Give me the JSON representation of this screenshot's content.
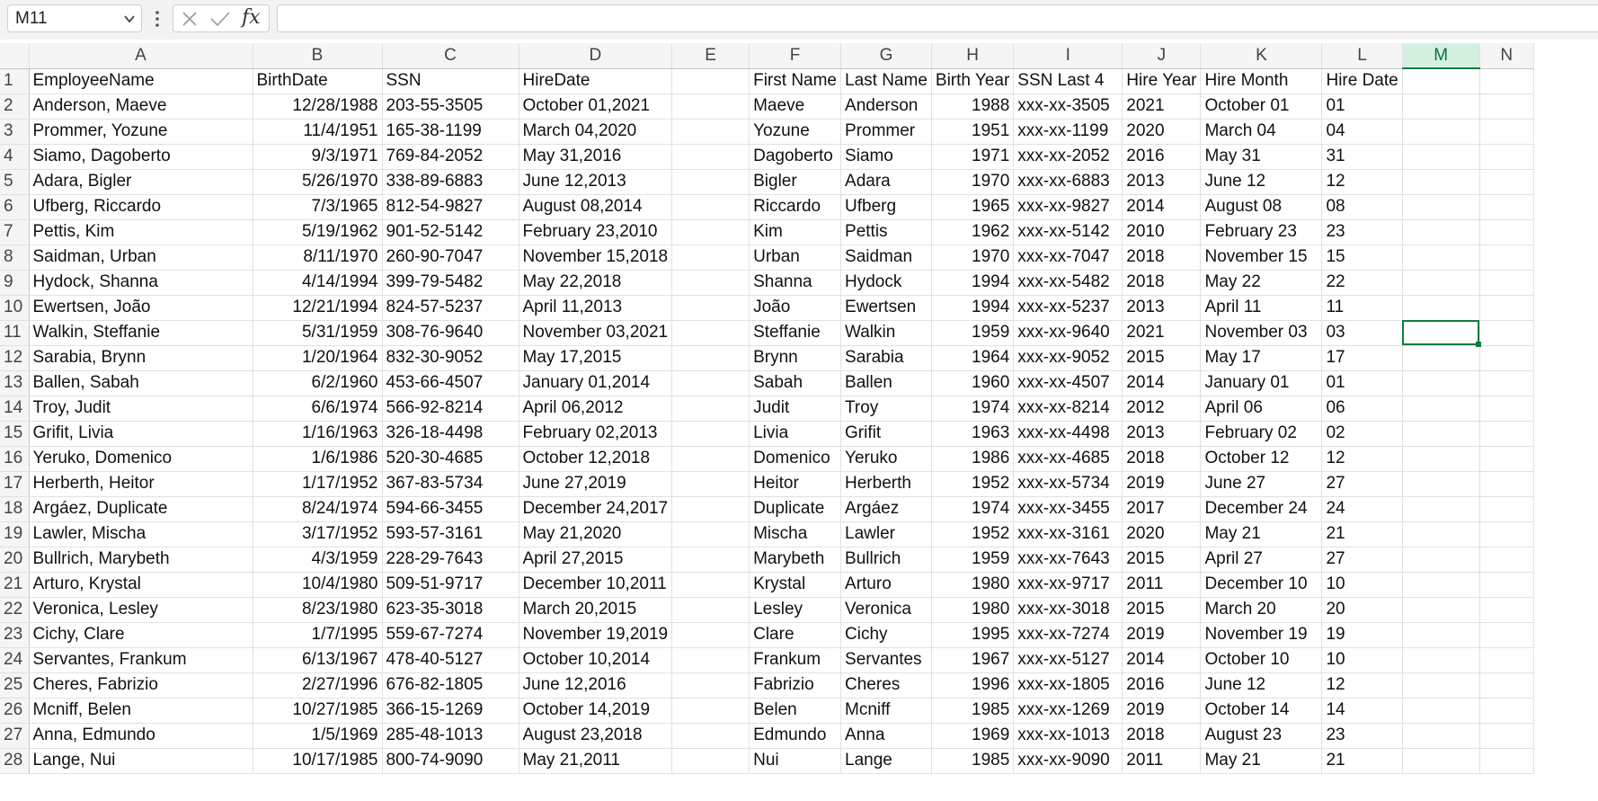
{
  "formula_bar": {
    "name_box": "M11",
    "function_symbol": "fx",
    "formula_value": ""
  },
  "columns": [
    "A",
    "B",
    "C",
    "D",
    "E",
    "F",
    "G",
    "H",
    "I",
    "J",
    "K",
    "L",
    "M",
    "N"
  ],
  "selected": {
    "column": "M",
    "row": "11"
  },
  "headers": [
    "EmployeeName",
    "BirthDate",
    "SSN",
    "HireDate",
    "",
    "First Name",
    "Last Name",
    "Birth Year",
    "SSN Last 4",
    "Hire Year",
    "Hire Month",
    "Hire Date",
    "",
    ""
  ],
  "rows": [
    [
      "Anderson, Maeve",
      "12/28/1988",
      "203-55-3505",
      "October 01,2021",
      "",
      "Maeve",
      "Anderson",
      "1988",
      "xxx-xx-3505",
      "2021",
      "October 01",
      "01",
      "",
      ""
    ],
    [
      "Prommer, Yozune",
      "11/4/1951",
      "165-38-1199",
      "March 04,2020",
      "",
      "Yozune",
      "Prommer",
      "1951",
      "xxx-xx-1199",
      "2020",
      "March 04",
      "04",
      "",
      ""
    ],
    [
      "Siamo, Dagoberto",
      "9/3/1971",
      "769-84-2052",
      "May 31,2016",
      "",
      "Dagoberto",
      "Siamo",
      "1971",
      "xxx-xx-2052",
      "2016",
      "May 31",
      "31",
      "",
      ""
    ],
    [
      "Adara, Bigler",
      "5/26/1970",
      "338-89-6883",
      "June 12,2013",
      "",
      "Bigler",
      "Adara",
      "1970",
      "xxx-xx-6883",
      "2013",
      "June 12",
      "12",
      "",
      ""
    ],
    [
      "Ufberg, Riccardo",
      "7/3/1965",
      "812-54-9827",
      "August 08,2014",
      "",
      "Riccardo",
      "Ufberg",
      "1965",
      "xxx-xx-9827",
      "2014",
      "August 08",
      "08",
      "",
      ""
    ],
    [
      "Pettis, Kim",
      "5/19/1962",
      "901-52-5142",
      "February 23,2010",
      "",
      "Kim",
      "Pettis",
      "1962",
      "xxx-xx-5142",
      "2010",
      "February 23",
      "23",
      "",
      ""
    ],
    [
      "Saidman, Urban",
      "8/11/1970",
      "260-90-7047",
      "November 15,2018",
      "",
      "Urban",
      "Saidman",
      "1970",
      "xxx-xx-7047",
      "2018",
      "November 15",
      "15",
      "",
      ""
    ],
    [
      "Hydock, Shanna",
      "4/14/1994",
      "399-79-5482",
      "May 22,2018",
      "",
      "Shanna",
      "Hydock",
      "1994",
      "xxx-xx-5482",
      "2018",
      "May 22",
      "22",
      "",
      ""
    ],
    [
      "Ewertsen, João",
      "12/21/1994",
      "824-57-5237",
      "April 11,2013",
      "",
      "João",
      "Ewertsen",
      "1994",
      "xxx-xx-5237",
      "2013",
      "April 11",
      "11",
      "",
      ""
    ],
    [
      "Walkin, Steffanie",
      "5/31/1959",
      "308-76-9640",
      "November 03,2021",
      "",
      "Steffanie",
      "Walkin",
      "1959",
      "xxx-xx-9640",
      "2021",
      "November 03",
      "03",
      "",
      ""
    ],
    [
      "Sarabia, Brynn",
      "1/20/1964",
      "832-30-9052",
      "May 17,2015",
      "",
      "Brynn",
      "Sarabia",
      "1964",
      "xxx-xx-9052",
      "2015",
      "May 17",
      "17",
      "",
      ""
    ],
    [
      "Ballen, Sabah",
      "6/2/1960",
      "453-66-4507",
      "January 01,2014",
      "",
      "Sabah",
      "Ballen",
      "1960",
      "xxx-xx-4507",
      "2014",
      "January 01",
      "01",
      "",
      ""
    ],
    [
      "Troy, Judit",
      "6/6/1974",
      "566-92-8214",
      "April 06,2012",
      "",
      "Judit",
      "Troy",
      "1974",
      "xxx-xx-8214",
      "2012",
      "April 06",
      "06",
      "",
      ""
    ],
    [
      "Grifit, Livia",
      "1/16/1963",
      "326-18-4498",
      "February 02,2013",
      "",
      "Livia",
      "Grifit",
      "1963",
      "xxx-xx-4498",
      "2013",
      "February 02",
      "02",
      "",
      ""
    ],
    [
      "Yeruko, Domenico",
      "1/6/1986",
      "520-30-4685",
      "October 12,2018",
      "",
      "Domenico",
      "Yeruko",
      "1986",
      "xxx-xx-4685",
      "2018",
      "October 12",
      "12",
      "",
      ""
    ],
    [
      "Herberth, Heitor",
      "1/17/1952",
      "367-83-5734",
      "June 27,2019",
      "",
      "Heitor",
      "Herberth",
      "1952",
      "xxx-xx-5734",
      "2019",
      "June 27",
      "27",
      "",
      ""
    ],
    [
      "Argáez, Duplicate",
      "8/24/1974",
      "594-66-3455",
      "December 24,2017",
      "",
      "Duplicate",
      "Argáez",
      "1974",
      "xxx-xx-3455",
      "2017",
      "December 24",
      "24",
      "",
      ""
    ],
    [
      "Lawler, Mischa",
      "3/17/1952",
      "593-57-3161",
      "May 21,2020",
      "",
      "Mischa",
      "Lawler",
      "1952",
      "xxx-xx-3161",
      "2020",
      "May 21",
      "21",
      "",
      ""
    ],
    [
      "Bullrich, Marybeth",
      "4/3/1959",
      "228-29-7643",
      "April 27,2015",
      "",
      "Marybeth",
      "Bullrich",
      "1959",
      "xxx-xx-7643",
      "2015",
      "April 27",
      "27",
      "",
      ""
    ],
    [
      "Arturo, Krystal",
      "10/4/1980",
      "509-51-9717",
      "December 10,2011",
      "",
      "Krystal",
      "Arturo",
      "1980",
      "xxx-xx-9717",
      "2011",
      "December 10",
      "10",
      "",
      ""
    ],
    [
      "Veronica, Lesley",
      "8/23/1980",
      "623-35-3018",
      "March 20,2015",
      "",
      "Lesley",
      "Veronica",
      "1980",
      "xxx-xx-3018",
      "2015",
      "March 20",
      "20",
      "",
      ""
    ],
    [
      "Cichy, Clare",
      "1/7/1995",
      "559-67-7274",
      "November 19,2019",
      "",
      "Clare",
      "Cichy",
      "1995",
      "xxx-xx-7274",
      "2019",
      "November 19",
      "19",
      "",
      ""
    ],
    [
      "Servantes, Frankum",
      "6/13/1967",
      "478-40-5127",
      "October 10,2014",
      "",
      "Frankum",
      "Servantes",
      "1967",
      "xxx-xx-5127",
      "2014",
      "October 10",
      "10",
      "",
      ""
    ],
    [
      "Cheres, Fabrizio",
      "2/27/1996",
      "676-82-1805",
      "June 12,2016",
      "",
      "Fabrizio",
      "Cheres",
      "1996",
      "xxx-xx-1805",
      "2016",
      "June 12",
      "12",
      "",
      ""
    ],
    [
      "Mcniff, Belen",
      "10/27/1985",
      "366-15-1269",
      "October 14,2019",
      "",
      "Belen",
      "Mcniff",
      "1985",
      "xxx-xx-1269",
      "2019",
      "October 14",
      "14",
      "",
      ""
    ],
    [
      "Anna, Edmundo",
      "1/5/1969",
      "285-48-1013",
      "August 23,2018",
      "",
      "Edmundo",
      "Anna",
      "1969",
      "xxx-xx-1013",
      "2018",
      "August 23",
      "23",
      "",
      ""
    ],
    [
      "Lange, Nui",
      "10/17/1985",
      "800-74-9090",
      "May 21,2011",
      "",
      "Nui",
      "Lange",
      "1985",
      "xxx-xx-9090",
      "2011",
      "May 21",
      "21",
      "",
      ""
    ]
  ]
}
